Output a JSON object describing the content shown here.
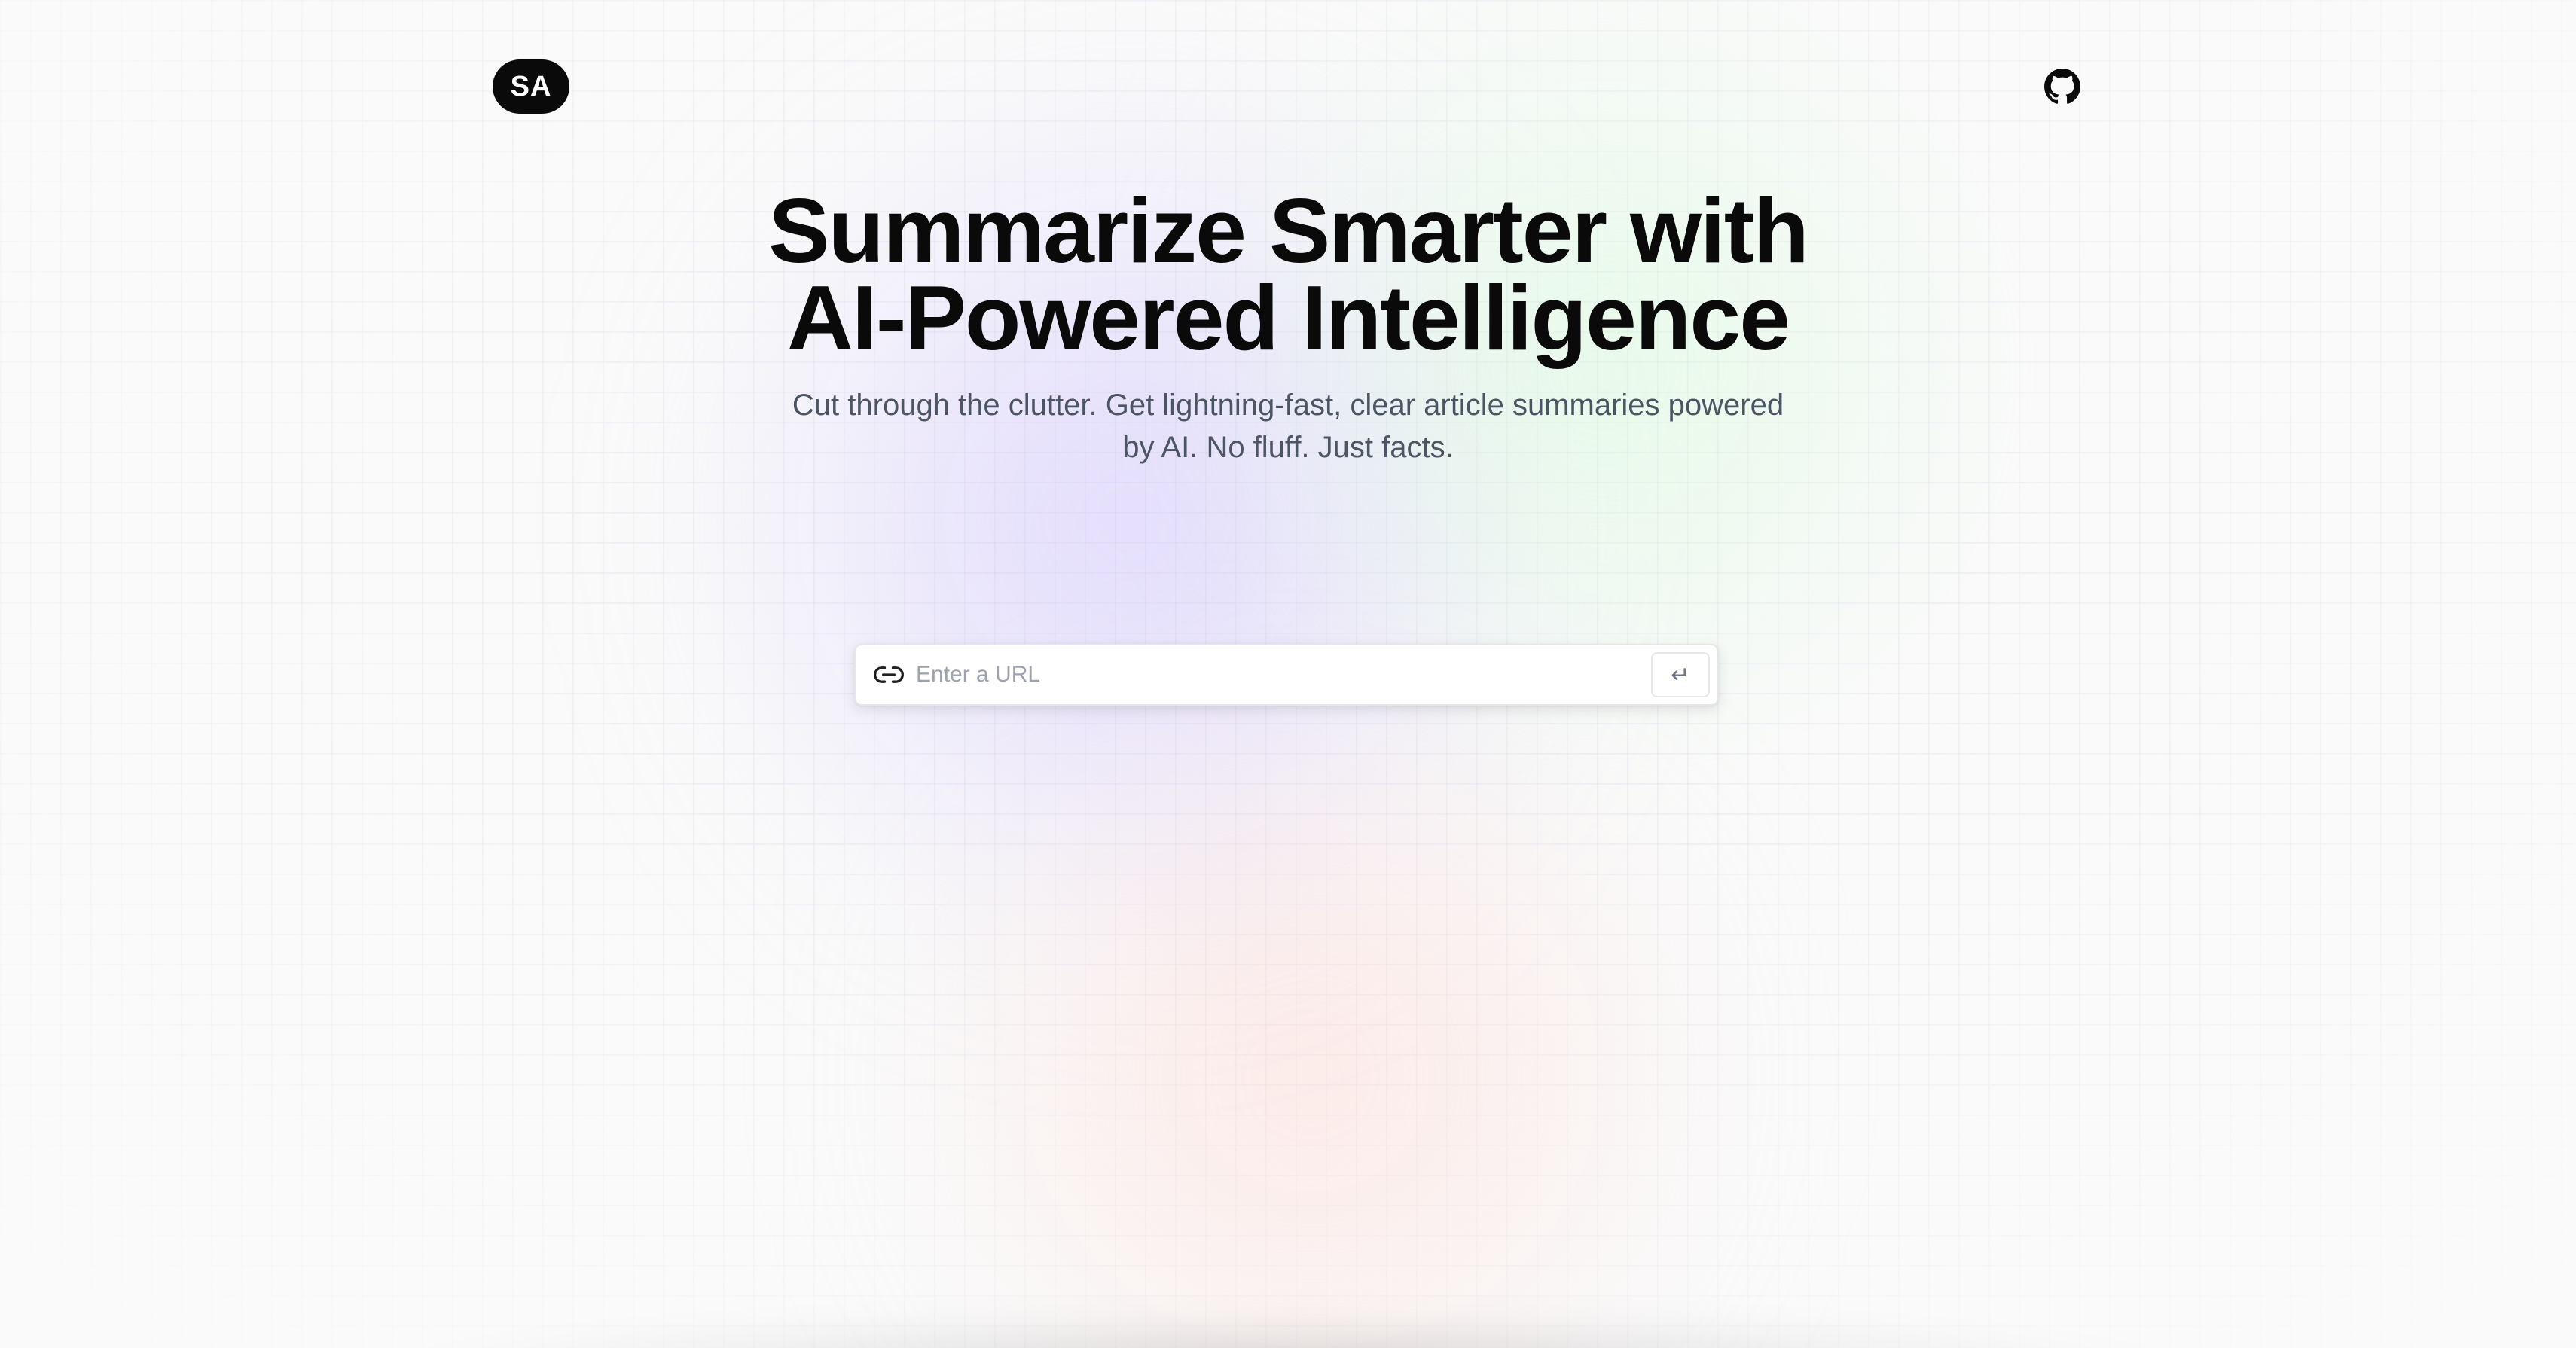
{
  "header": {
    "logo_text": "SA",
    "github_icon": "github-icon"
  },
  "hero": {
    "title_line1": "Summarize Smarter with",
    "title_line2": "AI-Powered Intelligence",
    "subtitle": "Cut through the clutter. Get lightning-fast, clear article summaries powered by AI. No fluff. Just facts."
  },
  "url_form": {
    "icon": "link-icon",
    "placeholder": "Enter a URL",
    "value": "",
    "submit_label": "↵"
  },
  "colors": {
    "background": "#fafafa",
    "text_primary": "#0a0a0a",
    "text_secondary": "#4b5563",
    "logo_bg": "#0a0a0a",
    "logo_text": "#ffffff",
    "blob_violet": "#c8b9ff",
    "blob_green": "#cdfad2",
    "blob_pink": "#ffd2cd"
  }
}
